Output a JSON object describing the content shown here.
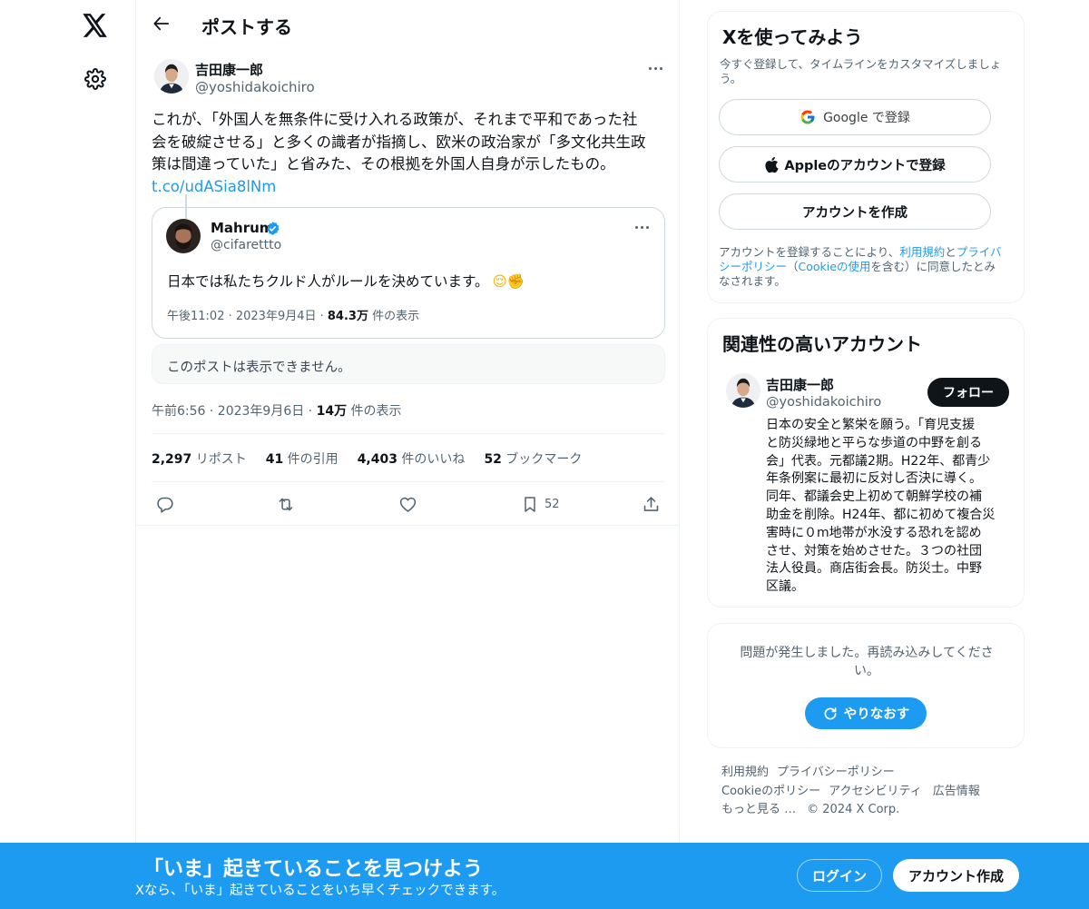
{
  "header": {
    "title": "ポストする"
  },
  "post": {
    "author_name": "吉田康一郎",
    "author_handle": "@yoshidakoichiro",
    "text_line1": "これが、「外国人を無条件に受け入れる政策が、それまで平和であった社",
    "text_line2": "会を破綻させる」と多くの識者が指摘し、欧米の政治家が「多文化共生政",
    "text_line3": "策は間違っていた」と省みた、その根拠を外国人自身が示したもの。",
    "link": "t.co/udASia8lNm",
    "quote": {
      "author_name": "Mahrum",
      "author_handle": "@cifarettto",
      "text": "日本では私たちクルド人がルールを決めています。",
      "emoji": "😌✊",
      "time": "午後11:02 · 2023年9月4日 · ",
      "views": "84.3万",
      "views_label": " 件の表示"
    },
    "unavailable_text": "このポストは表示できません。",
    "meta_time": "午前6:56 · 2023年9月6日 · ",
    "meta_views": "14万",
    "meta_views_label": " 件の表示",
    "stats": {
      "reposts": "2,297",
      "reposts_label": " リポスト",
      "quotes": "41",
      "quotes_label": " 件の引用",
      "likes": "4,403",
      "likes_label": " 件のいいね",
      "bookmarks": "52",
      "bookmarks_label": " ブックマーク"
    },
    "bookmark_count": "52"
  },
  "signup": {
    "title": "Xを使ってみよう",
    "subtitle_line1": "今すぐ登録して、タイムラインをカスタマイズしましょ",
    "subtitle_line2": "う。",
    "google_label": "Google で登録",
    "apple_label": "Appleのアカウントで登録",
    "create_label": "アカウントを作成",
    "terms": {
      "l1a": "アカウントを登録することにより、",
      "l1b": "利用規約",
      "l1c": "と",
      "l1d": "プライバ",
      "l2a": "シーポリシー",
      "l2b": "（",
      "l2c": "Cookieの使用",
      "l2d": "を含む）に同意したとみ",
      "l3": "なされます。"
    }
  },
  "relevant": {
    "title": "関連性の高いアカウント",
    "name": "吉田康一郎",
    "handle": "@yoshidakoichiro",
    "follow_label": "フォロー",
    "bio_lines": [
      "日本の安全と繁栄を願う。「育児支援",
      "と防災緑地と平らな歩道の中野を創る",
      "会」代表。元都議2期。H22年、都青少",
      "年条例案に最初に反対し否決に導く。",
      "同年、都議会史上初めて朝鮮学校の補",
      "助金を削除。H24年、都に初めて複合災",
      "害時に０m地帯が水没する恐れを認め",
      "させ、対策を始めさせた。３つの社団",
      "法人役員。商店街会長。防災士。中野",
      "区議。"
    ]
  },
  "error": {
    "line1": "問題が発生しました。再読み込みしてくださ",
    "line2": "い。",
    "retry_label": "やりなおす"
  },
  "footer_links": {
    "terms": "利用規約",
    "privacy": "プライバシーポリシー",
    "cookie": "Cookieのポリシー",
    "accessibility": "アクセシビリティ",
    "ads": "広告情報",
    "more": "もっと見る …",
    "copyright": "© 2024 X Corp."
  },
  "banner": {
    "title": "「いま」起きていることを見つけよう",
    "subtitle": "Xなら、「いま」起きていることをいち早くチェックできます。",
    "login_label": "ログイン",
    "signup_label": "アカウント作成"
  },
  "colors": {
    "accent": "#1d9bf0",
    "text": "#0f1419",
    "muted": "#536471",
    "border": "#eff3f4"
  }
}
